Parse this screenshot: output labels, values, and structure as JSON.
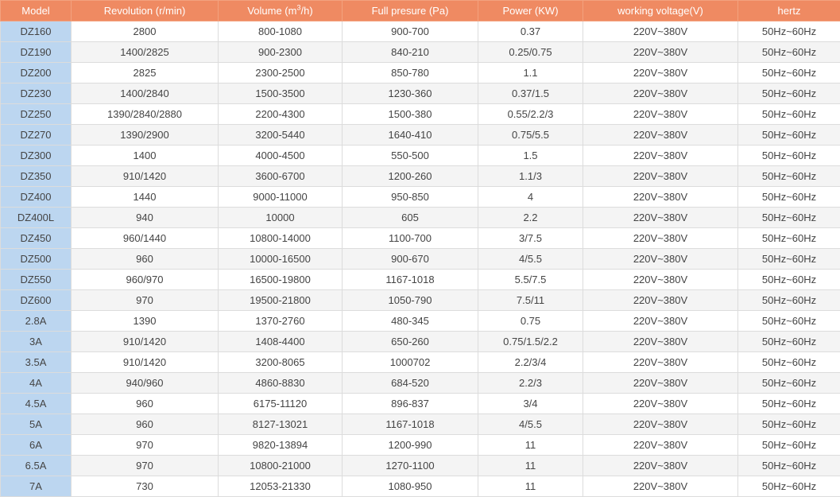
{
  "table": {
    "headers": {
      "model": "Model",
      "revolution": "Revolution (r/min)",
      "volume_prefix": "Volume (m",
      "volume_sup": "3",
      "volume_suffix": "/h)",
      "pressure": "Full presure (Pa)",
      "power": "Power (KW)",
      "voltage": "working voltage(V)",
      "hertz": "hertz"
    },
    "rows": [
      [
        "DZ160",
        "2800",
        "800-1080",
        "900-700",
        "0.37",
        "220V~380V",
        "50Hz~60Hz"
      ],
      [
        "DZ190",
        "1400/2825",
        "900-2300",
        "840-210",
        "0.25/0.75",
        "220V~380V",
        "50Hz~60Hz"
      ],
      [
        "DZ200",
        "2825",
        "2300-2500",
        "850-780",
        "1.1",
        "220V~380V",
        "50Hz~60Hz"
      ],
      [
        "DZ230",
        "1400/2840",
        "1500-3500",
        "1230-360",
        "0.37/1.5",
        "220V~380V",
        "50Hz~60Hz"
      ],
      [
        "DZ250",
        "1390/2840/2880",
        "2200-4300",
        "1500-380",
        "0.55/2.2/3",
        "220V~380V",
        "50Hz~60Hz"
      ],
      [
        "DZ270",
        "1390/2900",
        "3200-5440",
        "1640-410",
        "0.75/5.5",
        "220V~380V",
        "50Hz~60Hz"
      ],
      [
        "DZ300",
        "1400",
        "4000-4500",
        "550-500",
        "1.5",
        "220V~380V",
        "50Hz~60Hz"
      ],
      [
        "DZ350",
        "910/1420",
        "3600-6700",
        "1200-260",
        "1.1/3",
        "220V~380V",
        "50Hz~60Hz"
      ],
      [
        "DZ400",
        "1440",
        "9000-11000",
        "950-850",
        "4",
        "220V~380V",
        "50Hz~60Hz"
      ],
      [
        "DZ400L",
        "940",
        "10000",
        "605",
        "2.2",
        "220V~380V",
        "50Hz~60Hz"
      ],
      [
        "DZ450",
        "960/1440",
        "10800-14000",
        "1100-700",
        "3/7.5",
        "220V~380V",
        "50Hz~60Hz"
      ],
      [
        "DZ500",
        "960",
        "10000-16500",
        "900-670",
        "4/5.5",
        "220V~380V",
        "50Hz~60Hz"
      ],
      [
        "DZ550",
        "960/970",
        "16500-19800",
        "1167-1018",
        "5.5/7.5",
        "220V~380V",
        "50Hz~60Hz"
      ],
      [
        "DZ600",
        "970",
        "19500-21800",
        "1050-790",
        "7.5/11",
        "220V~380V",
        "50Hz~60Hz"
      ],
      [
        "2.8A",
        "1390",
        "1370-2760",
        "480-345",
        "0.75",
        "220V~380V",
        "50Hz~60Hz"
      ],
      [
        "3A",
        "910/1420",
        "1408-4400",
        "650-260",
        "0.75/1.5/2.2",
        "220V~380V",
        "50Hz~60Hz"
      ],
      [
        "3.5A",
        "910/1420",
        "3200-8065",
        "1000702",
        "2.2/3/4",
        "220V~380V",
        "50Hz~60Hz"
      ],
      [
        "4A",
        "940/960",
        "4860-8830",
        "684-520",
        "2.2/3",
        "220V~380V",
        "50Hz~60Hz"
      ],
      [
        "4.5A",
        "960",
        "6175-11120",
        "896-837",
        "3/4",
        "220V~380V",
        "50Hz~60Hz"
      ],
      [
        "5A",
        "960",
        "8127-13021",
        "1167-1018",
        "4/5.5",
        "220V~380V",
        "50Hz~60Hz"
      ],
      [
        "6A",
        "970",
        "9820-13894",
        "1200-990",
        "11",
        "220V~380V",
        "50Hz~60Hz"
      ],
      [
        "6.5A",
        "970",
        "10800-21000",
        "1270-1100",
        "11",
        "220V~380V",
        "50Hz~60Hz"
      ],
      [
        "7A",
        "730",
        "12053-21330",
        "1080-950",
        "11",
        "220V~380V",
        "50Hz~60Hz"
      ]
    ]
  },
  "colors": {
    "header_bg": "#ef8a62",
    "model_col_bg": "#bcd6f0",
    "stripe_bg": "#f4f4f4"
  }
}
